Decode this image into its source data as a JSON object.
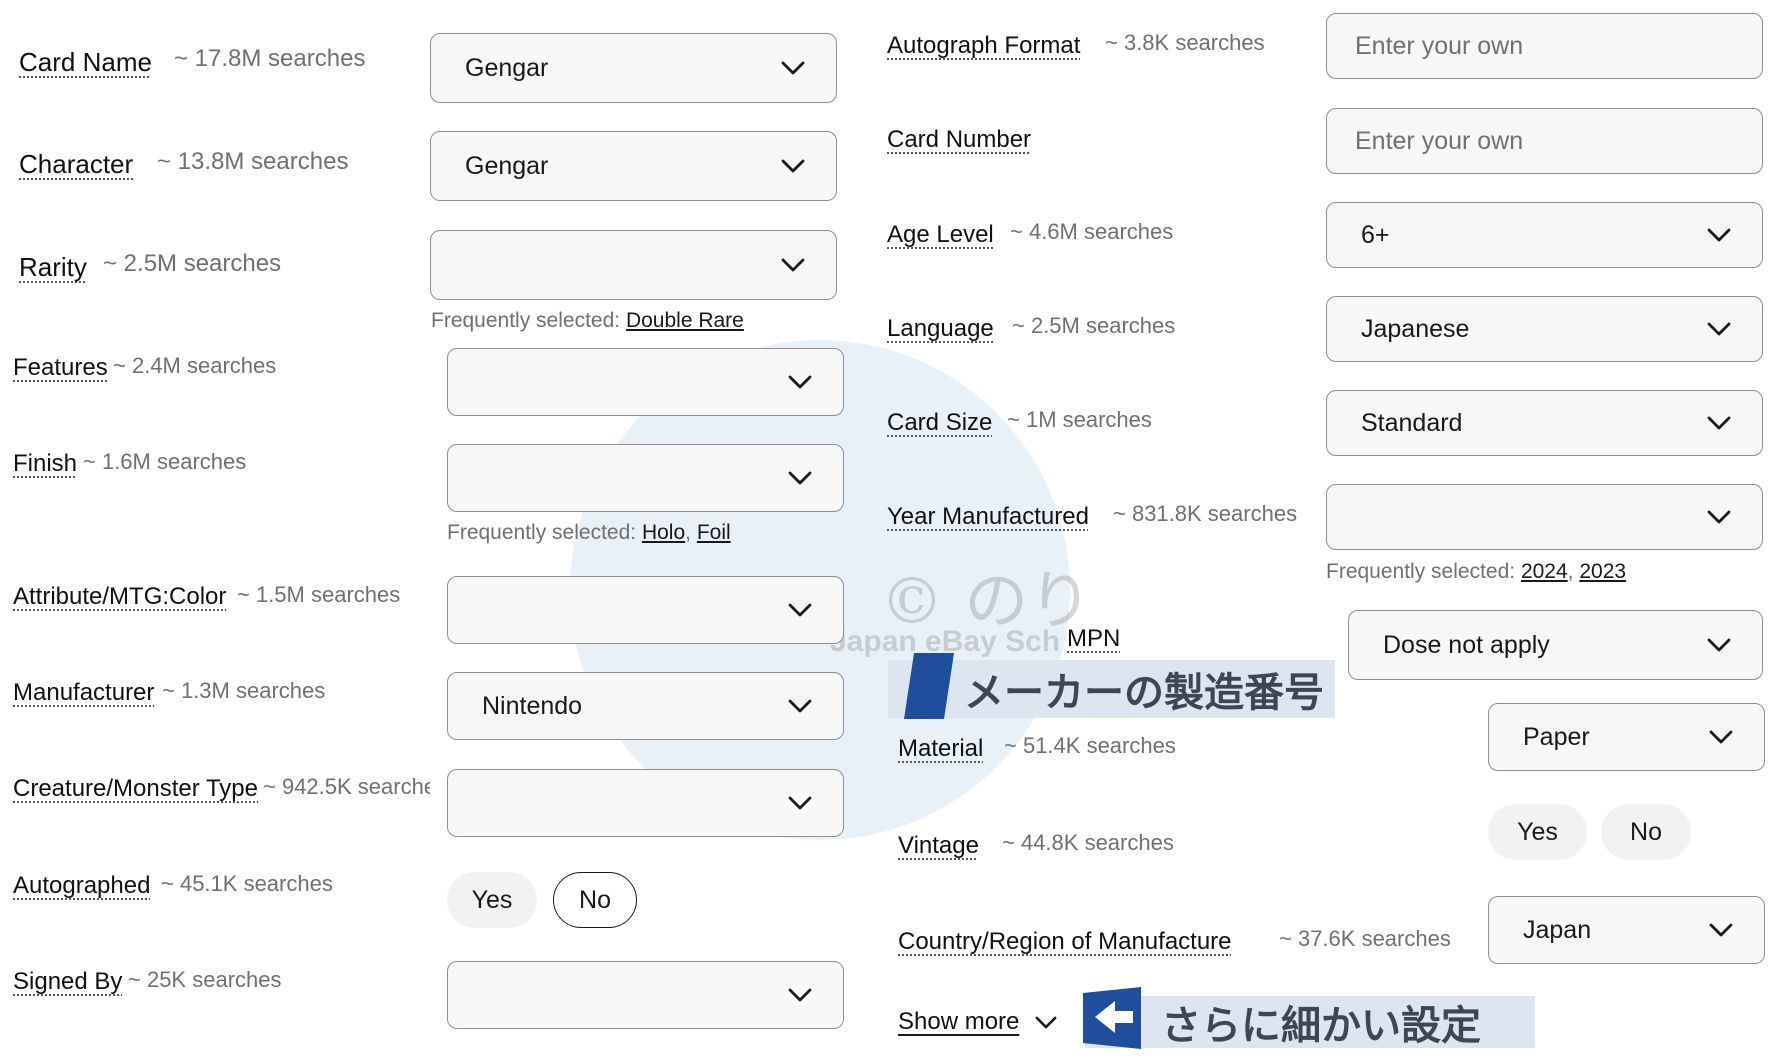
{
  "left_fields": [
    {
      "label": "Card Name",
      "hint": "~ 17.8M searches",
      "value": "Gengar"
    },
    {
      "label": "Character",
      "hint": "~ 13.8M searches",
      "value": "Gengar"
    },
    {
      "label": "Rarity",
      "hint": "~ 2.5M searches",
      "value": "",
      "freq_prefix": "Frequently selected:",
      "freq": [
        "Double Rare"
      ]
    },
    {
      "label": "Features",
      "hint": "~ 2.4M searches",
      "value": ""
    },
    {
      "label": "Finish",
      "hint": "~ 1.6M searches",
      "value": "",
      "freq_prefix": "Frequently selected:",
      "freq": [
        "Holo",
        "Foil"
      ]
    },
    {
      "label": "Attribute/MTG:Color",
      "hint": "~ 1.5M searches",
      "value": ""
    },
    {
      "label": "Manufacturer",
      "hint": "~ 1.3M searches",
      "value": "Nintendo"
    },
    {
      "label": "Creature/Monster Type",
      "hint": "~ 942.5K searche",
      "value": ""
    },
    {
      "label": "Autographed",
      "hint": "~ 45.1K searches",
      "options": [
        "Yes",
        "No"
      ],
      "selected": "No"
    },
    {
      "label": "Signed By",
      "hint": "~ 25K searches",
      "value": ""
    }
  ],
  "right_fields": [
    {
      "label": "Autograph Format",
      "hint": "~ 3.8K searches",
      "placeholder": "Enter your own"
    },
    {
      "label": "Card Number",
      "hint": "",
      "placeholder": "Enter your own"
    },
    {
      "label": "Age Level",
      "hint": "~ 4.6M searches",
      "value": "6+"
    },
    {
      "label": "Language",
      "hint": "~ 2.5M searches",
      "value": "Japanese"
    },
    {
      "label": "Card Size",
      "hint": "~ 1M searches",
      "value": "Standard"
    },
    {
      "label": "Year Manufactured",
      "hint": "~ 831.8K searches",
      "value": "",
      "freq_prefix": "Frequently selected:",
      "freq": [
        "2024",
        "2023"
      ]
    },
    {
      "label": "MPN",
      "value": "Dose not apply"
    },
    {
      "label": "Material",
      "hint": "~ 51.4K searches",
      "value": "Paper"
    },
    {
      "label": "Vintage",
      "hint": "~ 44.8K searches",
      "options": [
        "Yes",
        "No"
      ]
    },
    {
      "label": "Country/Region of Manufacture",
      "hint": "~ 37.6K searches",
      "value": "Japan"
    }
  ],
  "show_more": "Show more",
  "annotations": {
    "mpn_note": "メーカーの製造番号",
    "show_more_note": "さらに細かい設定"
  },
  "watermark": {
    "mark": "© のり",
    "subtitle": "Japan eBay Sch"
  },
  "colors": {
    "accent_banner": "#dde5f1",
    "arrow_blue": "#1f4e9c",
    "text": "#191919",
    "muted": "#707070"
  }
}
